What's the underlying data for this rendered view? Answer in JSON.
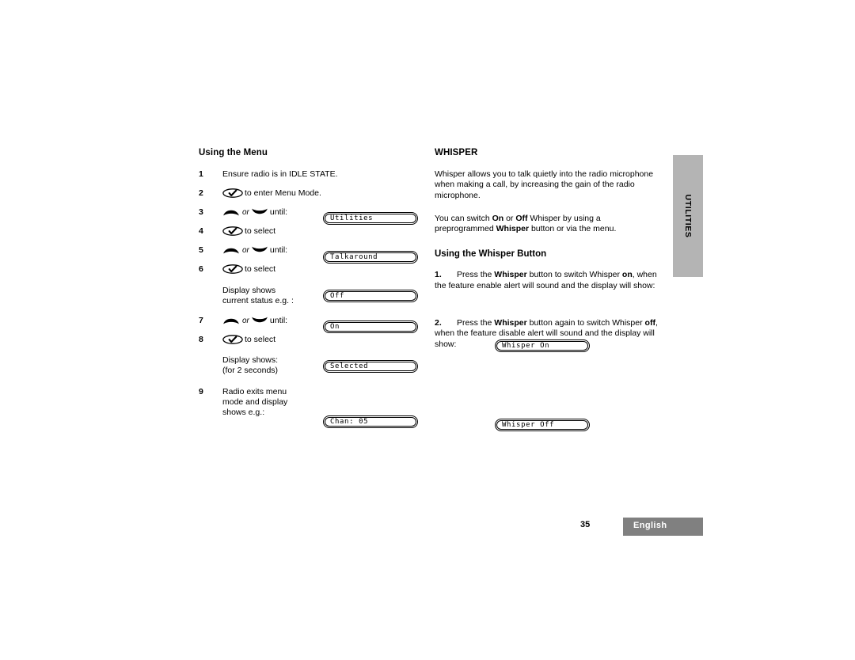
{
  "document": {
    "page_number": "35",
    "language_label": "English",
    "side_tab_label": "UTILITIES"
  },
  "left_column": {
    "heading": "Using the Menu",
    "steps": [
      {
        "num": "1",
        "text": "Ensure radio is in IDLE STATE."
      },
      {
        "num": "2",
        "icon": "menu-select-key",
        "text": "to enter Menu Mode."
      },
      {
        "num": "3",
        "icon": "up-down-keys",
        "or_label": "or",
        "text": "until:",
        "lcd": "Utilities"
      },
      {
        "num": "4",
        "icon": "menu-select-key",
        "text": "to select"
      },
      {
        "num": "5",
        "icon": "up-down-keys",
        "or_label": "or",
        "text": "until:",
        "lcd": "Talkaround"
      },
      {
        "num": "6",
        "icon": "menu-select-key",
        "text": "to select"
      },
      {
        "num": "",
        "text_line1": "Display shows",
        "text_line2": "current status e.g. :",
        "lcd": "Off"
      },
      {
        "num": "7",
        "icon": "up-down-keys",
        "or_label": "or",
        "text": "until:",
        "lcd": "On"
      },
      {
        "num": "8",
        "icon": "menu-select-key",
        "text": "to select"
      },
      {
        "num": "",
        "text_line1": "Display shows:",
        "text_line2": "(for 2 seconds)",
        "lcd": "Selected"
      },
      {
        "num": "9",
        "text_line1": "Radio exits menu",
        "text_line2": "mode and display",
        "text_line3": "shows e.g.:",
        "lcd": "Chan: 05"
      }
    ]
  },
  "right_column": {
    "heading": "WHISPER",
    "paragraph_1": {
      "part_1": "Whisper allows you to talk quietly into the radio microphone when making a call, by increasing the gain of the radio microphone."
    },
    "paragraph_2": {
      "part_1": "You can switch ",
      "bold_1": "On",
      "part_2": " or ",
      "bold_2": "Off",
      "part_3": " Whisper by using a preprogrammed ",
      "bold_3": "Whisper",
      "part_4": " button or via the menu."
    },
    "subheading": "Using the Whisper Button",
    "items": [
      {
        "num": "1.",
        "part_1": "Press the ",
        "bold_1": "Whisper",
        "part_2": " button to switch Whisper ",
        "bold_2": "on",
        "part_3": ", when the feature enable alert will sound and the display will show:",
        "lcd": "Whisper On"
      },
      {
        "num": "2.",
        "part_1": "Press the ",
        "bold_1": "Whisper",
        "part_2": " button again to switch Whisper ",
        "bold_2": "off",
        "part_3": ", when the feature disable alert will sound and the display will show:",
        "lcd": "Whisper Off"
      }
    ]
  },
  "colors": {
    "side_tab_gray": "#b4b4b4",
    "footer_gray": "#808080",
    "text": "#000000",
    "page_background": "#ffffff"
  }
}
